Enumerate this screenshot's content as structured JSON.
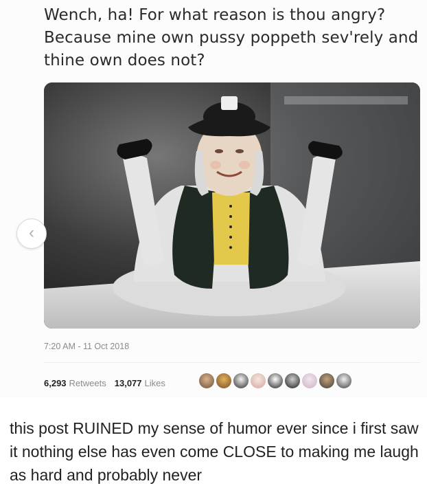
{
  "tweet": {
    "text": "Wench, ha! For what reason is thou angry? Because mine own pussy poppeth sev'rely and thine own does not?",
    "timestamp": "7:20 AM - 11 Oct 2018",
    "retweets_count": "6,293",
    "retweets_label": "Retweets",
    "likes_count": "13,077",
    "likes_label": "Likes",
    "liker_avatars": [
      "avatar-1",
      "avatar-2",
      "avatar-3",
      "avatar-4",
      "avatar-5",
      "avatar-6",
      "avatar-7",
      "avatar-8",
      "avatar-9"
    ],
    "photo_icon": "ceramic-figurine-jug-photo"
  },
  "carousel": {
    "prev_icon": "chevron-left-icon",
    "prev_glyph": "‹"
  },
  "caption": {
    "text": "this post RUINED my sense of humor ever since i first saw it nothing else has even come CLOSE to making me laugh as hard and probably never"
  },
  "colors": {
    "background": "#ffffff",
    "muted_text": "#8a8a8a",
    "divider": "#e6ecf0"
  }
}
